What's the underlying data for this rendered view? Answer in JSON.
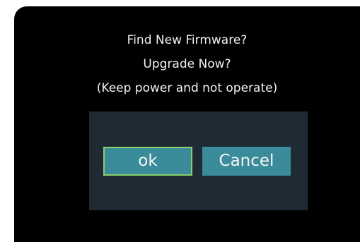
{
  "dialog": {
    "message_lines": [
      "Find New Firmware?",
      "Upgrade Now?",
      "(Keep power and not operate)"
    ],
    "buttons": {
      "ok_label": "ok",
      "cancel_label": "Cancel"
    }
  },
  "colors": {
    "dialog_background": "#000000",
    "panel_background": "#1f2a35",
    "button_fill": "#3b8c9a",
    "focus_border": "#8bd06a",
    "text": "#f2f2f2"
  }
}
